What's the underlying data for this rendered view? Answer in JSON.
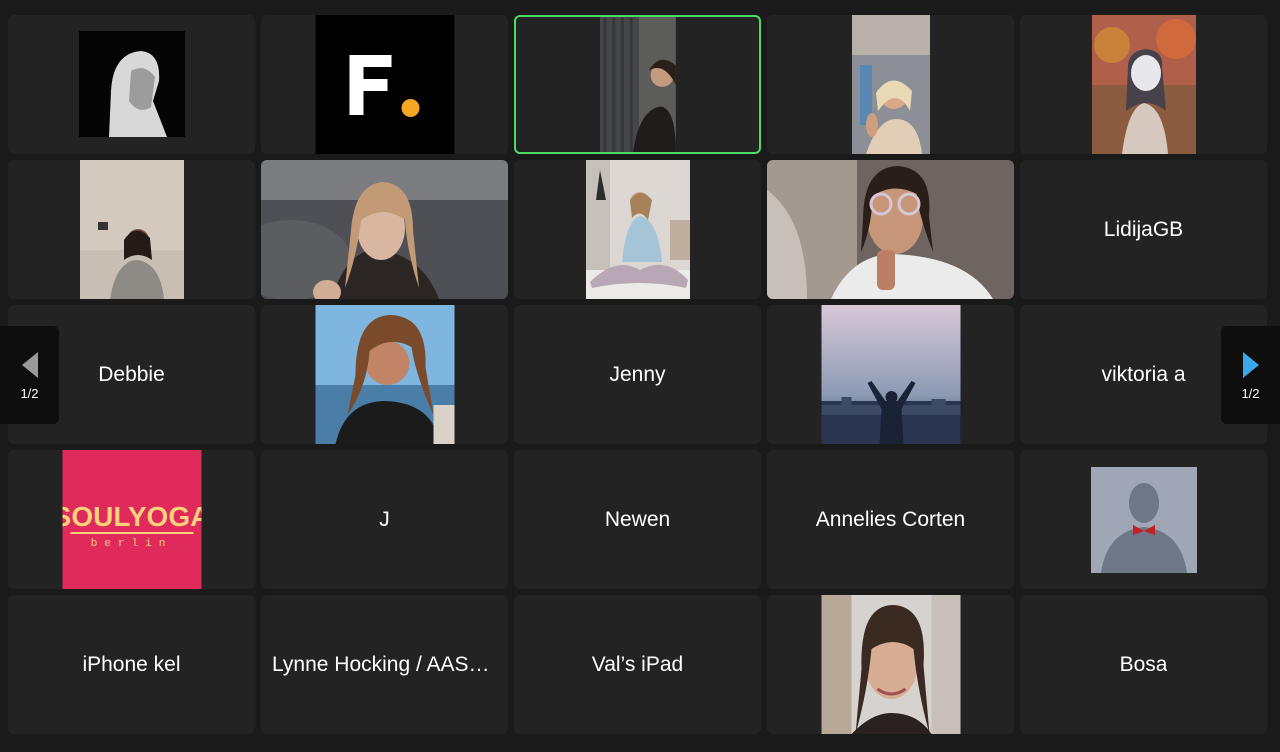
{
  "tiles": [
    {
      "name": "",
      "video": "bw-portrait-woman"
    },
    {
      "name": "",
      "video": "f-dot-logo"
    },
    {
      "name": "",
      "video": "woman-curtain-room",
      "active": true
    },
    {
      "name": "",
      "video": "woman-blonde-room"
    },
    {
      "name": "",
      "video": "masked-person-tree"
    },
    {
      "name": "",
      "video": "woman-bedroom"
    },
    {
      "name": "",
      "video": "woman-blurred-background"
    },
    {
      "name": "",
      "video": "woman-sitting-floor"
    },
    {
      "name": "",
      "video": "woman-glasses-closeup"
    },
    {
      "name": "LidijaGB"
    },
    {
      "name": "Debbie"
    },
    {
      "name": "",
      "video": "woman-beach"
    },
    {
      "name": "Jenny"
    },
    {
      "name": "",
      "video": "person-arms-raised-dusk"
    },
    {
      "name": "viktoria a"
    },
    {
      "name": "",
      "video": "soulyoga-logo",
      "logo_text": "SOULYOGA",
      "logo_sub": "berlin"
    },
    {
      "name": "J"
    },
    {
      "name": "Newen"
    },
    {
      "name": "Annelies Corten"
    },
    {
      "name": "",
      "video": "silhouette-bowtie-avatar"
    },
    {
      "name": "iPhone kel"
    },
    {
      "name": "Lynne Hocking / AASHNI YOGA"
    },
    {
      "name": "Val’s iPad"
    },
    {
      "name": "",
      "video": "woman-smiling-portrait"
    },
    {
      "name": "Bosa"
    }
  ],
  "pagination": {
    "left_label": "1/2",
    "right_label": "1/2"
  },
  "colors": {
    "active_border": "#4cd964",
    "next_arrow": "#3aa7e8",
    "prev_arrow": "#9a9a9a",
    "soulyoga_bg": "#e02a5c",
    "soulyoga_text": "#f7d27a"
  }
}
